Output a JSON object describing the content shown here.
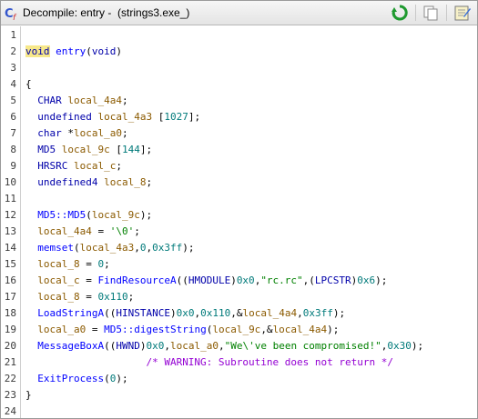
{
  "window": {
    "title": "Decompile: entry -  (strings3.exe_)"
  },
  "toolbar": {
    "icons": [
      "refresh-icon",
      "copy-icon",
      "snapshot-icon",
      "edit-icon"
    ]
  },
  "lines": [
    {
      "num": "1",
      "tokens": []
    },
    {
      "num": "2",
      "tokens": [
        [
          "void",
          "void-hl"
        ],
        [
          " ",
          "plain"
        ],
        [
          "entry",
          "func"
        ],
        [
          "(",
          "plain"
        ],
        [
          "void",
          "type"
        ],
        [
          ")",
          "plain"
        ]
      ]
    },
    {
      "num": "3",
      "tokens": []
    },
    {
      "num": "4",
      "tokens": [
        [
          "{",
          "plain"
        ]
      ]
    },
    {
      "num": "5",
      "tokens": [
        [
          "  ",
          "plain"
        ],
        [
          "CHAR",
          "type"
        ],
        [
          " ",
          "plain"
        ],
        [
          "local_4a4",
          "var"
        ],
        [
          ";",
          "plain"
        ]
      ]
    },
    {
      "num": "6",
      "tokens": [
        [
          "  ",
          "plain"
        ],
        [
          "undefined",
          "type"
        ],
        [
          " ",
          "plain"
        ],
        [
          "local_4a3",
          "var"
        ],
        [
          " [",
          "plain"
        ],
        [
          "1027",
          "num"
        ],
        [
          "];",
          "plain"
        ]
      ]
    },
    {
      "num": "7",
      "tokens": [
        [
          "  ",
          "plain"
        ],
        [
          "char",
          "type"
        ],
        [
          " *",
          "plain"
        ],
        [
          "local_a0",
          "var"
        ],
        [
          ";",
          "plain"
        ]
      ]
    },
    {
      "num": "8",
      "tokens": [
        [
          "  ",
          "plain"
        ],
        [
          "MD5",
          "type"
        ],
        [
          " ",
          "plain"
        ],
        [
          "local_9c",
          "var"
        ],
        [
          " [",
          "plain"
        ],
        [
          "144",
          "num"
        ],
        [
          "];",
          "plain"
        ]
      ]
    },
    {
      "num": "9",
      "tokens": [
        [
          "  ",
          "plain"
        ],
        [
          "HRSRC",
          "type"
        ],
        [
          " ",
          "plain"
        ],
        [
          "local_c",
          "var"
        ],
        [
          ";",
          "plain"
        ]
      ]
    },
    {
      "num": "10",
      "tokens": [
        [
          "  ",
          "plain"
        ],
        [
          "undefined4",
          "type"
        ],
        [
          " ",
          "plain"
        ],
        [
          "local_8",
          "var"
        ],
        [
          ";",
          "plain"
        ]
      ]
    },
    {
      "num": "11",
      "tokens": []
    },
    {
      "num": "12",
      "tokens": [
        [
          "  ",
          "plain"
        ],
        [
          "MD5::MD5",
          "func"
        ],
        [
          "(",
          "plain"
        ],
        [
          "local_9c",
          "var"
        ],
        [
          ");",
          "plain"
        ]
      ]
    },
    {
      "num": "13",
      "tokens": [
        [
          "  ",
          "plain"
        ],
        [
          "local_4a4",
          "var"
        ],
        [
          " = ",
          "plain"
        ],
        [
          "'\\0'",
          "str"
        ],
        [
          ";",
          "plain"
        ]
      ]
    },
    {
      "num": "14",
      "tokens": [
        [
          "  ",
          "plain"
        ],
        [
          "memset",
          "func"
        ],
        [
          "(",
          "plain"
        ],
        [
          "local_4a3",
          "var"
        ],
        [
          ",",
          "plain"
        ],
        [
          "0",
          "num"
        ],
        [
          ",",
          "plain"
        ],
        [
          "0x3ff",
          "num"
        ],
        [
          ");",
          "plain"
        ]
      ]
    },
    {
      "num": "15",
      "tokens": [
        [
          "  ",
          "plain"
        ],
        [
          "local_8",
          "var"
        ],
        [
          " = ",
          "plain"
        ],
        [
          "0",
          "num"
        ],
        [
          ";",
          "plain"
        ]
      ]
    },
    {
      "num": "16",
      "tokens": [
        [
          "  ",
          "plain"
        ],
        [
          "local_c",
          "var"
        ],
        [
          " = ",
          "plain"
        ],
        [
          "FindResourceA",
          "func"
        ],
        [
          "((",
          "plain"
        ],
        [
          "HMODULE",
          "type"
        ],
        [
          ")",
          "plain"
        ],
        [
          "0x0",
          "num"
        ],
        [
          ",",
          "plain"
        ],
        [
          "\"rc.rc\"",
          "str"
        ],
        [
          ",(",
          "plain"
        ],
        [
          "LPCSTR",
          "type"
        ],
        [
          ")",
          "plain"
        ],
        [
          "0x6",
          "num"
        ],
        [
          ");",
          "plain"
        ]
      ]
    },
    {
      "num": "17",
      "tokens": [
        [
          "  ",
          "plain"
        ],
        [
          "local_8",
          "var"
        ],
        [
          " = ",
          "plain"
        ],
        [
          "0x110",
          "num"
        ],
        [
          ";",
          "plain"
        ]
      ]
    },
    {
      "num": "18",
      "tokens": [
        [
          "  ",
          "plain"
        ],
        [
          "LoadStringA",
          "func"
        ],
        [
          "((",
          "plain"
        ],
        [
          "HINSTANCE",
          "type"
        ],
        [
          ")",
          "plain"
        ],
        [
          "0x0",
          "num"
        ],
        [
          ",",
          "plain"
        ],
        [
          "0x110",
          "num"
        ],
        [
          ",&",
          "plain"
        ],
        [
          "local_4a4",
          "var"
        ],
        [
          ",",
          "plain"
        ],
        [
          "0x3ff",
          "num"
        ],
        [
          ");",
          "plain"
        ]
      ]
    },
    {
      "num": "19",
      "tokens": [
        [
          "  ",
          "plain"
        ],
        [
          "local_a0",
          "var"
        ],
        [
          " = ",
          "plain"
        ],
        [
          "MD5::digestString",
          "func"
        ],
        [
          "(",
          "plain"
        ],
        [
          "local_9c",
          "var"
        ],
        [
          ",&",
          "plain"
        ],
        [
          "local_4a4",
          "var"
        ],
        [
          ");",
          "plain"
        ]
      ]
    },
    {
      "num": "20",
      "tokens": [
        [
          "  ",
          "plain"
        ],
        [
          "MessageBoxA",
          "func"
        ],
        [
          "((",
          "plain"
        ],
        [
          "HWND",
          "type"
        ],
        [
          ")",
          "plain"
        ],
        [
          "0x0",
          "num"
        ],
        [
          ",",
          "plain"
        ],
        [
          "local_a0",
          "var"
        ],
        [
          ",",
          "plain"
        ],
        [
          "\"We\\'ve been compromised!\"",
          "str"
        ],
        [
          ",",
          "plain"
        ],
        [
          "0x30",
          "num"
        ],
        [
          ");",
          "plain"
        ]
      ]
    },
    {
      "num": "21",
      "tokens": [
        [
          "                    ",
          "plain"
        ],
        [
          "/* WARNING: Subroutine does not return */",
          "comment"
        ]
      ]
    },
    {
      "num": "22",
      "tokens": [
        [
          "  ",
          "plain"
        ],
        [
          "ExitProcess",
          "func"
        ],
        [
          "(",
          "plain"
        ],
        [
          "0",
          "num"
        ],
        [
          ");",
          "plain"
        ]
      ]
    },
    {
      "num": "23",
      "tokens": [
        [
          "}",
          "plain"
        ]
      ]
    },
    {
      "num": "24",
      "tokens": []
    }
  ]
}
